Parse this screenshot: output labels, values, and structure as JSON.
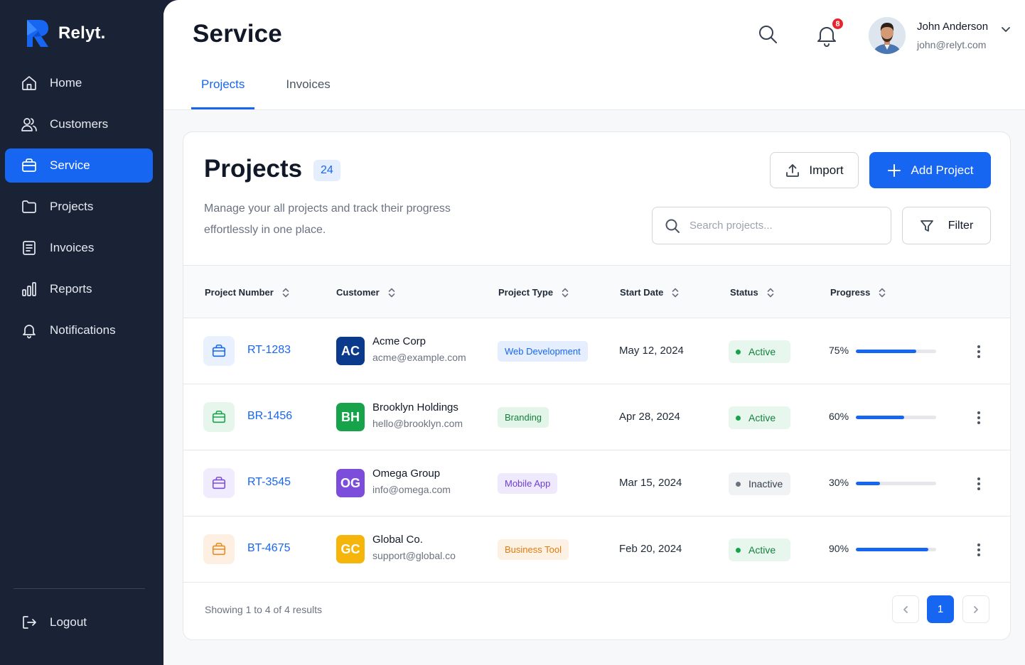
{
  "brand": {
    "name": "Relyt."
  },
  "sidebar": {
    "items": [
      {
        "label": "Home",
        "icon": "home-icon"
      },
      {
        "label": "Customers",
        "icon": "users-icon"
      },
      {
        "label": "Service",
        "icon": "briefcase-icon",
        "active": true
      },
      {
        "label": "Projects",
        "icon": "folder-icon"
      },
      {
        "label": "Invoices",
        "icon": "document-icon"
      },
      {
        "label": "Reports",
        "icon": "bar-chart-icon"
      },
      {
        "label": "Notifications",
        "icon": "bell-icon"
      }
    ],
    "logout_label": "Logout"
  },
  "header": {
    "title": "Service",
    "notification_count": "8",
    "user": {
      "name": "John Anderson",
      "email": "john@relyt.com"
    }
  },
  "tabs": [
    {
      "label": "Projects",
      "active": true
    },
    {
      "label": "Invoices",
      "active": false
    }
  ],
  "card": {
    "title": "Projects",
    "count": "24",
    "description": "Manage your all projects and track their progress effortlessly in one place.",
    "import_label": "Import",
    "add_label": "Add Project",
    "search_placeholder": "Search projects...",
    "filter_label": "Filter"
  },
  "table": {
    "columns": [
      "Project Number",
      "Customer",
      "Project Type",
      "Start Date",
      "Status",
      "Progress"
    ],
    "rows": [
      {
        "number": "RT-1283",
        "initials": "AC",
        "customer": "Acme Corp",
        "email": "acme@example.com",
        "type": "Web Development",
        "start": "May 12, 2024",
        "status": "Active",
        "progress_label": "75%",
        "progress": 0.75,
        "theme": "blue"
      },
      {
        "number": "BR-1456",
        "initials": "BH",
        "customer": "Brooklyn Holdings",
        "email": "hello@brooklyn.com",
        "type": "Branding",
        "start": "Apr 28, 2024",
        "status": "Active",
        "progress_label": "60%",
        "progress": 0.6,
        "theme": "green"
      },
      {
        "number": "RT-3545",
        "initials": "OG",
        "customer": "Omega Group",
        "email": "info@omega.com",
        "type": "Mobile App",
        "start": "Mar 15, 2024",
        "status": "Inactive",
        "progress_label": "30%",
        "progress": 0.3,
        "theme": "purple"
      },
      {
        "number": "BT-4675",
        "initials": "GC",
        "customer": "Global Co.",
        "email": "support@global.co",
        "type": "Business Tool",
        "start": "Feb 20, 2024",
        "status": "Active",
        "progress_label": "90%",
        "progress": 0.9,
        "theme": "orange"
      }
    ]
  },
  "pagination": {
    "summary": "Showing 1 to 4 of 4 results",
    "current_page": "1"
  },
  "colors": {
    "accent": "#1766f2",
    "sidebar": "#1a2336",
    "active_status": "#16a34a"
  }
}
